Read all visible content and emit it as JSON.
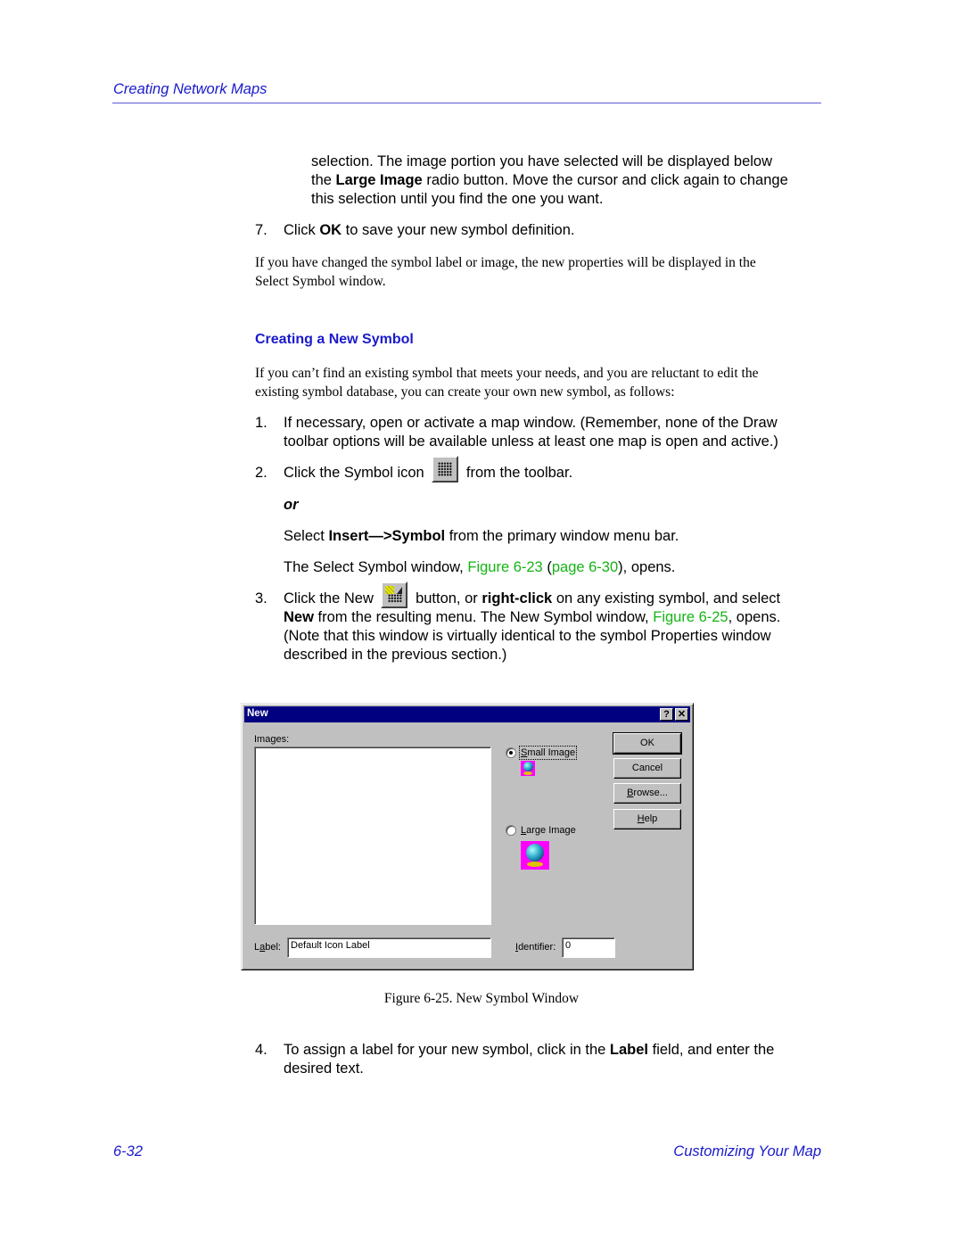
{
  "header": {
    "running_title": "Creating Network Maps"
  },
  "intro": {
    "continued_line1": "selection. The image portion you have selected will be displayed below",
    "continued_line2_pre": "the ",
    "continued_line2_bold": "Large Image",
    "continued_line2_post": " radio button. Move the cursor and click again to change",
    "continued_line3": "this selection until you find the one you want.",
    "step7_num": "7.",
    "step7_pre": "Click ",
    "step7_bold": "OK",
    "step7_post": " to save your new symbol definition.",
    "note_line1": "If you have changed the symbol label or image, the new properties will be displayed in the",
    "note_line2": "Select Symbol window."
  },
  "section": {
    "heading": "Creating a New Symbol",
    "intro_line1": "If you can’t find an existing symbol that meets your needs, and you are reluctant to edit the",
    "intro_line2": "existing symbol database, you can create your own new symbol, as follows:",
    "step1_num": "1.",
    "step1_line1": "If necessary, open or activate a map window. (Remember, none of the Draw",
    "step1_line2": "toolbar options will be available unless at least one map is open and active.)",
    "step2_num": "2.",
    "step2_pre": "Click the Symbol icon",
    "step2_post": "from the toolbar.",
    "or_text": "or",
    "alt_pre": "Select ",
    "alt_bold": "Insert—>Symbol",
    "alt_post": " from the primary window menu bar.",
    "opens_pre": "The Select Symbol window, ",
    "opens_link1": "Figure 6-23",
    "opens_mid": " (",
    "opens_link2": "page 6-30",
    "opens_post": "), opens.",
    "step3_num": "3.",
    "step3_pre": "Click the New",
    "step3_mid1": "button, or ",
    "step3_bold1": "right-click",
    "step3_mid2": " on any existing symbol, and select",
    "step3_l2_bold": "New",
    "step3_l2_mid": " from the resulting menu. The New Symbol window, ",
    "step3_l2_link": "Figure 6-25",
    "step3_l2_post": ", opens.",
    "step3_line3": "(Note that this window is virtually identical to the symbol Properties window",
    "step3_line4": "described in the previous section.)",
    "step4_num": "4.",
    "step4_pre": "To assign a label for your new symbol, click in the ",
    "step4_bold": "Label",
    "step4_post": " field, and enter the",
    "step4_line2": "desired text."
  },
  "dialog": {
    "title": "New",
    "help_glyph": "?",
    "close_glyph": "✕",
    "images_label": "Images:",
    "small_image_label": "Small Image",
    "small_image_selected": true,
    "large_image_label": "Large Image",
    "large_image_selected": false,
    "buttons": {
      "ok": "OK",
      "cancel": "Cancel",
      "browse": "Browse...",
      "help": "Help"
    },
    "label_field_label": "Label:",
    "label_field_value": "Default Icon Label",
    "identifier_label": "Identifier:",
    "identifier_value": "0",
    "images": [
      "globe-icon"
    ]
  },
  "figure": {
    "caption": "Figure 6-25.  New Symbol Window"
  },
  "footer": {
    "page_number": "6-32",
    "chapter_title": "Customizing Your Map"
  },
  "colors": {
    "heading_blue": "#1a1acc",
    "link_green": "#14b414",
    "titlebar": "#000080",
    "dialog_gray": "#c0c0c0"
  }
}
